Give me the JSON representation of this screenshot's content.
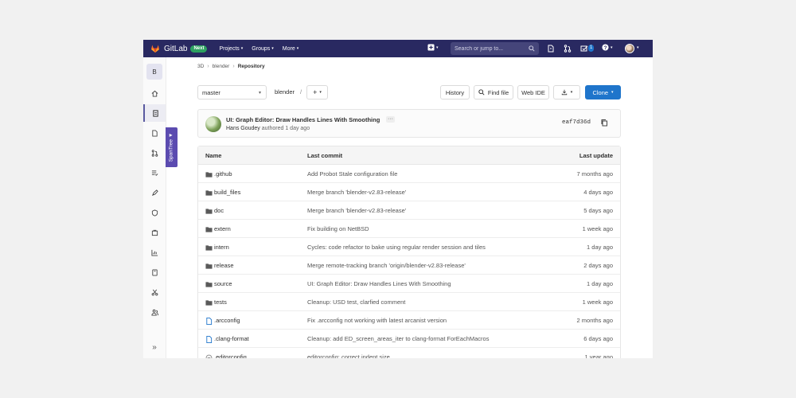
{
  "navbar": {
    "brand": "GitLab",
    "badge": "Next",
    "menu": [
      {
        "label": "Projects"
      },
      {
        "label": "Groups"
      },
      {
        "label": "More"
      }
    ],
    "search_placeholder": "Search or jump to...",
    "todo_count": "1",
    "accent_color": "#292961"
  },
  "sidebar": {
    "project_initial": "B",
    "items": [
      "project-overview",
      "repository",
      "issues",
      "merge-requests",
      "requirements",
      "ci-cd",
      "security",
      "packages",
      "analytics",
      "wiki",
      "snippets",
      "members"
    ],
    "collapse_label": "»"
  },
  "spantree": {
    "label": "SpanTree ▼"
  },
  "breadcrumb": {
    "items": [
      "3D",
      "blender",
      "Repository"
    ]
  },
  "toolbar": {
    "branch": "master",
    "path_root": "blender",
    "path_sep": "/",
    "history_label": "History",
    "find_file_label": "Find file",
    "web_ide_label": "Web IDE",
    "clone_label": "Clone"
  },
  "last_commit": {
    "title": "UI: Graph Editor: Draw Handles Lines With Smoothing",
    "ellipsis": "···",
    "author": "Hans Goudey",
    "authored_text": "authored 1 day ago",
    "sha": "eaf7d36d"
  },
  "table": {
    "headers": {
      "name": "Name",
      "last_commit": "Last commit",
      "last_update": "Last update"
    },
    "rows": [
      {
        "type": "folder",
        "name": ".github",
        "message": "Add Probot Stale configuration file",
        "date": "7 months ago"
      },
      {
        "type": "folder",
        "name": "build_files",
        "message": "Merge branch 'blender-v2.83-release'",
        "date": "4 days ago"
      },
      {
        "type": "folder",
        "name": "doc",
        "message": "Merge branch 'blender-v2.83-release'",
        "date": "5 days ago"
      },
      {
        "type": "folder",
        "name": "extern",
        "message": "Fix building on NetBSD",
        "date": "1 week ago"
      },
      {
        "type": "folder",
        "name": "intern",
        "message": "Cycles: code refactor to bake using regular render session and tiles",
        "date": "1 day ago"
      },
      {
        "type": "folder",
        "name": "release",
        "message": "Merge remote-tracking branch 'origin/blender-v2.83-release'",
        "date": "2 days ago"
      },
      {
        "type": "folder",
        "name": "source",
        "message": "UI: Graph Editor: Draw Handles Lines With Smoothing",
        "date": "1 day ago"
      },
      {
        "type": "folder",
        "name": "tests",
        "message": "Cleanup: USD test, clarfied comment",
        "date": "1 week ago"
      },
      {
        "type": "file",
        "name": ".arcconfig",
        "message": "Fix .arcconfig not working with latest arcanist version",
        "date": "2 months ago"
      },
      {
        "type": "file",
        "name": ".clang-format",
        "message": "Cleanup: add ED_screen_areas_iter to clang-format ForEachMacros",
        "date": "6 days ago"
      },
      {
        "type": "file-ec",
        "name": ".editorconfig",
        "message": "editorconfig: correct indent size",
        "date": "1 year ago"
      }
    ]
  }
}
